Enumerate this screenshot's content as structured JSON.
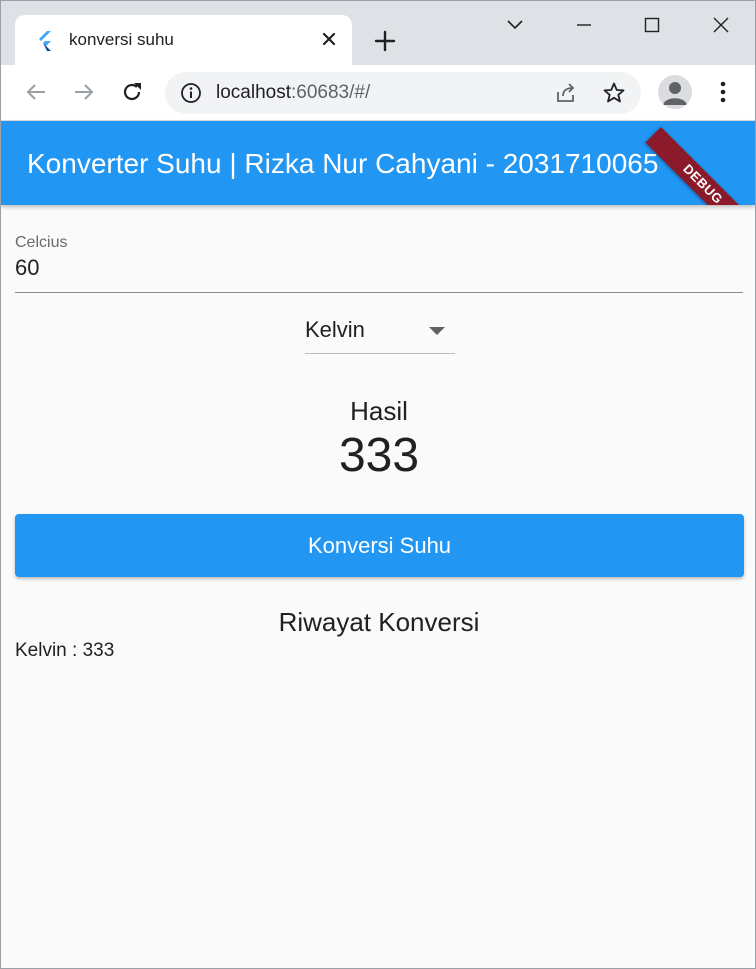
{
  "browser": {
    "tab": {
      "title": "konversi suhu"
    },
    "address": {
      "host": "localhost",
      "rest": ":60683/#/"
    }
  },
  "app": {
    "title": "Konverter Suhu | Rizka Nur Cahyani - 2031710065",
    "debug_label": "DEBUG",
    "input": {
      "label": "Celcius",
      "value": "60"
    },
    "dropdown": {
      "selected": "Kelvin"
    },
    "result": {
      "label": "Hasil",
      "value": "333"
    },
    "convert_button": "Konversi Suhu",
    "history": {
      "title": "Riwayat Konversi",
      "items": [
        "Kelvin : 333"
      ]
    },
    "colors": {
      "primary": "#2196f3",
      "debug": "#8b1a2b"
    }
  }
}
